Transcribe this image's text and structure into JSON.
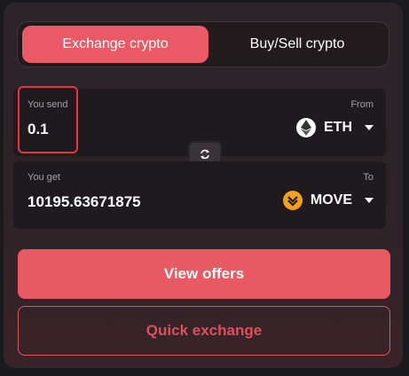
{
  "tabs": {
    "exchange_label": "Exchange crypto",
    "buysell_label": "Buy/Sell crypto"
  },
  "send": {
    "label": "You send",
    "from_label": "From",
    "amount": "0.1",
    "coin": "ETH",
    "coin_icon": "ethereum-icon"
  },
  "get": {
    "label": "You get",
    "to_label": "To",
    "amount": "10195.63671875",
    "coin": "MOVE",
    "coin_icon": "move-token-icon"
  },
  "actions": {
    "view_offers_label": "View offers",
    "quick_exchange_label": "Quick exchange"
  },
  "colors": {
    "accent": "#ea5a66",
    "highlight": "#e8343f",
    "background": "#2b2428"
  }
}
